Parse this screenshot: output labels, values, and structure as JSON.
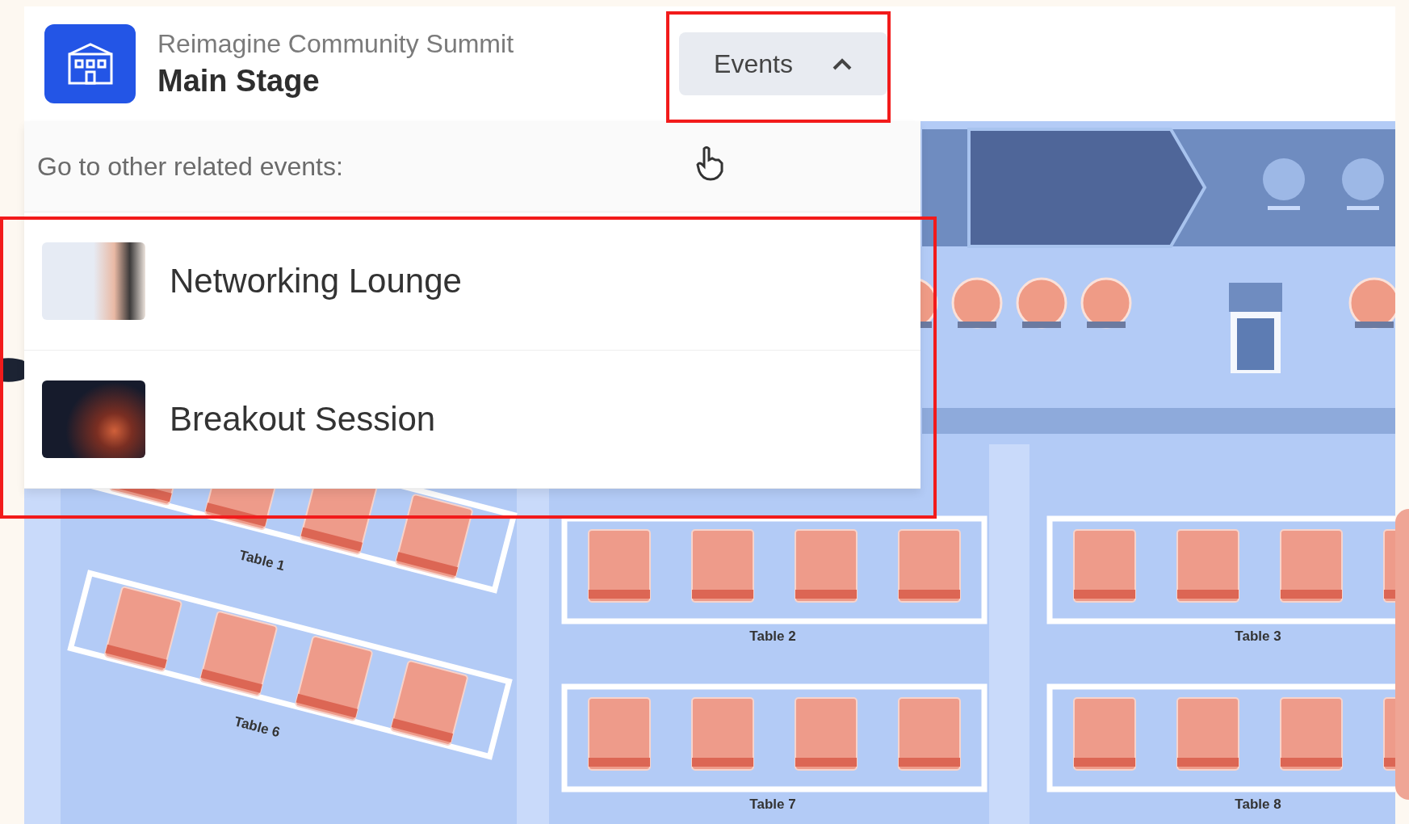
{
  "header": {
    "series": "Reimagine Community Summit",
    "title": "Main Stage",
    "events_button": {
      "label": "Events",
      "expanded": true
    }
  },
  "related_events": {
    "prompt": "Go to other related events:",
    "items": [
      {
        "name": "Networking Lounge",
        "kind": "light"
      },
      {
        "name": "Breakout Session",
        "kind": "dark"
      }
    ]
  },
  "floor_plan": {
    "tables": [
      {
        "label": "Table 1",
        "kind": "angled"
      },
      {
        "label": "Table 6",
        "kind": "angled"
      },
      {
        "label": "Table 2",
        "kind": "straight"
      },
      {
        "label": "Table 3",
        "kind": "straight"
      },
      {
        "label": "Table 7",
        "kind": "straight"
      },
      {
        "label": "Table 8",
        "kind": "straight"
      }
    ]
  }
}
